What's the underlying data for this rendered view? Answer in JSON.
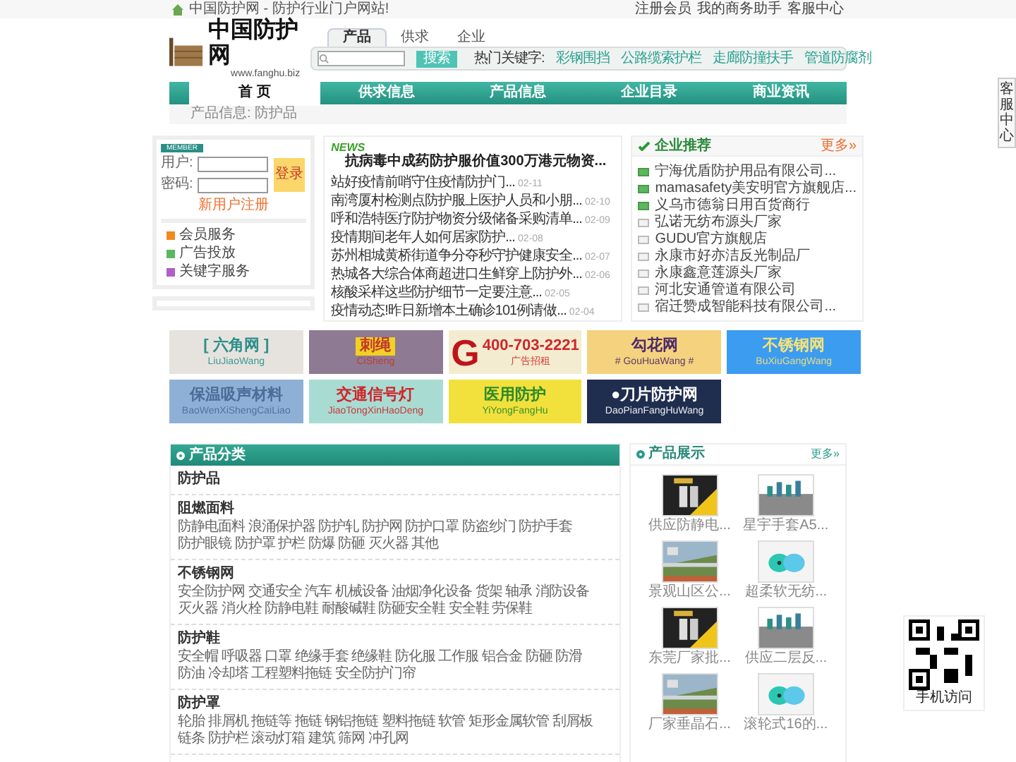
{
  "top_bar": {
    "welcome": "中国防护网 - 防护行业门户网站!",
    "links": [
      "注册会员",
      "我的商务助手",
      "客服中心"
    ]
  },
  "logo": {
    "name": "中国防护网",
    "url": "www.fanghu.biz"
  },
  "search": {
    "tabs": [
      {
        "label": "产品",
        "selected": true
      },
      {
        "label": "供求",
        "selected": false
      },
      {
        "label": "企业",
        "selected": false
      }
    ],
    "button": "搜索",
    "hot_label": "热门关键字:",
    "hot_keywords": [
      "彩钢围挡",
      "公路缆索护栏",
      "走廊防撞扶手",
      "管道防腐剂"
    ]
  },
  "nav": [
    {
      "label": "首 页",
      "selected": true
    },
    {
      "label": "供求信息",
      "selected": false
    },
    {
      "label": "产品信息",
      "selected": false
    },
    {
      "label": "企业目录",
      "selected": false
    },
    {
      "label": "商业资讯",
      "selected": false
    }
  ],
  "breadcrumb": "产品信息: 防护品",
  "login": {
    "badge": "MEMBER",
    "user_label": "用户:",
    "password_label": "密码:",
    "button": "登录",
    "register": "新用户注册",
    "services": [
      {
        "label": "会员服务",
        "color": "#f08a1c"
      },
      {
        "label": "广告投放",
        "color": "#5cb85c"
      },
      {
        "label": "关键字服务",
        "color": "#b05fc8"
      }
    ]
  },
  "news": {
    "tag": "NEWS",
    "headline": "抗病毒中成药防护服价值300万港元物资...",
    "items": [
      {
        "title": "站好疫情前哨守住疫情防护门...",
        "date": "02-11"
      },
      {
        "title": "南湾厦村检测点防护服上医护人员和小朋...",
        "date": "02-10"
      },
      {
        "title": "呼和浩特医疗防护物资分级储备采购清单...",
        "date": "02-09"
      },
      {
        "title": "疫情期间老年人如何居家防护...",
        "date": "02-08"
      },
      {
        "title": "苏州相城黄桥街道争分夺秒守护健康安全...",
        "date": "02-07"
      },
      {
        "title": "热城各大综合体商超进口生鲜穿上防护外...",
        "date": "02-06"
      },
      {
        "title": "核酸采样这些防护细节一定要注意...",
        "date": "02-05"
      },
      {
        "title": "疫情动态!昨日新增本土确诊101例请做...",
        "date": "02-04"
      }
    ]
  },
  "enterprises": {
    "title": "企业推荐",
    "more": "更多»",
    "items": [
      {
        "name": "宁海优盾防护用品有限公司...",
        "featured": true
      },
      {
        "name": "mamasafety美安明官方旗舰店...",
        "featured": true
      },
      {
        "name": "义乌市德翁日用百货商行",
        "featured": true
      },
      {
        "name": "弘诺无纺布源头厂家",
        "featured": false
      },
      {
        "name": "GUDU官方旗舰店",
        "featured": false
      },
      {
        "name": "永康市好亦洁反光制品厂",
        "featured": false
      },
      {
        "name": "永康鑫意莲源头厂家",
        "featured": false
      },
      {
        "name": "河北安通管道有限公司",
        "featured": false
      },
      {
        "name": "宿迁赞成智能科技有限公司...",
        "featured": false
      }
    ]
  },
  "ads": [
    {
      "title": "[ 六角网 ]",
      "subtitle": "LiuJiaoWang",
      "color": "#e6e3df",
      "kind": "teal"
    },
    {
      "title": "刺绳",
      "subtitle": "CiSheng",
      "color": "#8e7a93",
      "kind": "boxed"
    },
    {
      "title": "400-703-2221",
      "subtitle": "广告招租",
      "mark": "G",
      "color": "#f3ecd0",
      "kind": "red"
    },
    {
      "title": "勾花网",
      "subtitle": "# GouHuaWang #",
      "color": "#f5d27e",
      "kind": "purple"
    },
    {
      "title": "不锈钢网",
      "subtitle": "BuXiuGangWang",
      "color": "#3b9cf0",
      "kind": "gold"
    },
    {
      "title": "保温吸声材料",
      "subtitle": "BaoWenXiShengCaiLiao",
      "color": "#8fb0d6",
      "kind": "slate"
    },
    {
      "title": "交通信号灯",
      "subtitle": "JiaoTongXinHaoDeng",
      "color": "#a8dcd3",
      "kind": "red"
    },
    {
      "title": "医用防护",
      "subtitle": "YiYongFangHu",
      "color": "#f2e13c",
      "kind": "green"
    },
    {
      "title": "●刀片防护网",
      "subtitle": "DaoPianFangHuWang",
      "color": "#1f2d4f",
      "kind": "white"
    }
  ],
  "categories": {
    "title": "产品分类",
    "groups": [
      {
        "name": "防护品"
      },
      {
        "name": "阻燃面料",
        "items": [
          "防静电面料",
          "浪涌保护器",
          "防护轧",
          "防护网",
          "防护口罩",
          "防盗纱门",
          "防护手套",
          "防护眼镜",
          "防护罩",
          "护栏",
          "防爆",
          "防砸",
          "灭火器",
          "其他"
        ]
      },
      {
        "name": "不锈钢网",
        "items": [
          "安全防护网",
          "交通安全",
          "汽车",
          "机械设备",
          "油烟净化设备",
          "货架",
          "轴承",
          "消防设备",
          "灭火器",
          "消火栓",
          "防静电鞋",
          "耐酸碱鞋",
          "防砸安全鞋",
          "安全鞋",
          "劳保鞋"
        ]
      },
      {
        "name": "防护鞋",
        "items": [
          "安全帽",
          "呼吸器",
          "口罩",
          "绝缘手套",
          "绝缘鞋",
          "防化服",
          "工作服",
          "铝合金",
          "防砸",
          "防滑",
          "防油",
          "冷却塔",
          "工程塑料拖链",
          "安全防护门帘"
        ]
      },
      {
        "name": "防护罩",
        "items": [
          "轮胎",
          "排屑机",
          "拖链等",
          "拖链",
          "钢铝拖链",
          "塑料拖链",
          "软管",
          "矩形金属软管",
          "刮屑板",
          "链条",
          "防护栏",
          "滚动灯箱",
          "建筑",
          "筛网",
          "冲孔网"
        ]
      }
    ]
  },
  "showcase": {
    "title": "产品展示",
    "more": "更多»",
    "products": [
      {
        "name": "供应防静电..."
      },
      {
        "name": "星宇手套A5..."
      },
      {
        "name": "景观山区公..."
      },
      {
        "name": "超柔软无纺..."
      },
      {
        "name": "东莞厂家批..."
      },
      {
        "name": "供应二层反..."
      },
      {
        "name": "厂家垂晶石..."
      },
      {
        "name": "滚轮式16的..."
      }
    ]
  },
  "qr": {
    "caption": "手机访问"
  },
  "float_tab": "客服中心"
}
